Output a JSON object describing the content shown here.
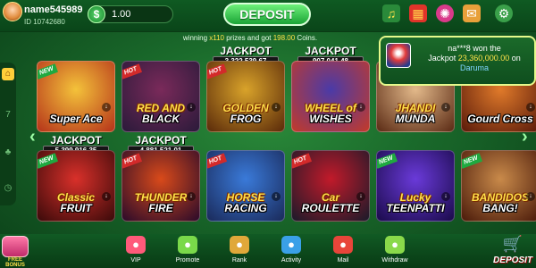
{
  "user": {
    "name": "name545989",
    "id_label": "ID 10742680"
  },
  "wallet": {
    "currency_symbol": "$",
    "balance": "1.00"
  },
  "header": {
    "deposit_label": "DEPOSIT"
  },
  "top_icons": [
    "gift-icon",
    "treasure-box-icon",
    "wheel-icon",
    "mail-icon",
    "settings-icon"
  ],
  "ticker": {
    "prefix": "winning ",
    "multiplier": "x110",
    "middle": " prizes and got ",
    "amount": "198.00",
    "suffix": " Coins."
  },
  "notification": {
    "player": "na***8 won the",
    "prefix": "Jackpot ",
    "amount": "23,360,000.00",
    "middle": " on",
    "game": "Daruma"
  },
  "jackpot_label": "JACKPOT",
  "games": [
    {
      "id": "super-ace",
      "name": "Super Ace",
      "badge": "NEW",
      "jackpot": null,
      "colors": [
        "#f4c23a",
        "#b5331a"
      ]
    },
    {
      "id": "red-and-black",
      "name": "RED AND BLACK",
      "line1": "RED AND",
      "line2": "BLACK",
      "badge": "HOT",
      "jackpot": null,
      "colors": [
        "#7a2a5a",
        "#2a1a3a"
      ]
    },
    {
      "id": "golden-frog",
      "name": "GOLDEN FROG",
      "line1": "GOLDEN",
      "line2": "FROG",
      "badge": "HOT",
      "jackpot": "3,322,539.67",
      "colors": [
        "#d9a32a",
        "#5a2a0a"
      ]
    },
    {
      "id": "wheel-of-wishes",
      "name": "WHEEL of WISHES",
      "line1": "WHEEL of",
      "line2": "WISHES",
      "badge": "",
      "jackpot": "907,041.48",
      "colors": [
        "#4a3aa8",
        "#c33a2a"
      ]
    },
    {
      "id": "jhandi-munda",
      "name": "JHANDI MUNDA",
      "line1": "JHANDI",
      "line2": "MUNDA",
      "badge": "",
      "jackpot": null,
      "colors": [
        "#e3b98a",
        "#5a2a14"
      ]
    },
    {
      "id": "gourd-cross",
      "name": "Gourd Cross",
      "badge": "",
      "jackpot": null,
      "colors": [
        "#e07a2a",
        "#5a1a0a"
      ]
    },
    {
      "id": "classic-fruit",
      "name": "Classic FRUIT",
      "line1": "Classic",
      "line2": "FRUIT",
      "badge": "NEW",
      "jackpot": "5,399,916.35",
      "colors": [
        "#d9302a",
        "#3a0a0a"
      ]
    },
    {
      "id": "thunder-fire",
      "name": "THUNDER FIRE",
      "line1": "THUNDER",
      "line2": "FIRE",
      "badge": "HOT",
      "jackpot": "4,881,521.01",
      "colors": [
        "#d94a1a",
        "#2a0a2a"
      ]
    },
    {
      "id": "horse-racing",
      "name": "HORSE RACING",
      "line1": "HORSE",
      "line2": "RACING",
      "badge": "HOT",
      "jackpot": null,
      "colors": [
        "#3a7ad9",
        "#1a2a5a"
      ]
    },
    {
      "id": "car-roulette",
      "name": "Car ROULETTE",
      "line1": "Car",
      "line2": "ROULETTE",
      "badge": "HOT",
      "jackpot": null,
      "colors": [
        "#c21a2a",
        "#1a1a2a"
      ]
    },
    {
      "id": "lucky-teenpatti",
      "name": "Lucky TEENPATTI",
      "line1": "Lucky",
      "line2": "TEENPATTI",
      "badge": "NEW",
      "jackpot": null,
      "colors": [
        "#6a3ad9",
        "#1a0a4a"
      ]
    },
    {
      "id": "bandidos-bang",
      "name": "BANDIDOS BANG",
      "line1": "BANDIDOS",
      "line2": "BANG!",
      "badge": "NEW",
      "jackpot": null,
      "colors": [
        "#c98a4a",
        "#4a1a0a"
      ]
    }
  ],
  "sidebar": {
    "items": [
      "home-icon",
      "777-icon",
      "cards-icon",
      "clock-icon"
    ]
  },
  "bottom_nav": {
    "free_bonus": "FREE BONUS",
    "items": [
      {
        "label": "VIP",
        "icon": "crown-icon",
        "color": "#ff5a7a"
      },
      {
        "label": "Promote",
        "icon": "money-bag-icon",
        "color": "#7ad94a"
      },
      {
        "label": "Rank",
        "icon": "trophy-icon",
        "color": "#e0a83a"
      },
      {
        "label": "Activity",
        "icon": "gift-box-icon",
        "color": "#3aa0e8"
      },
      {
        "label": "Mail",
        "icon": "mailbox-icon",
        "color": "#e8453a"
      },
      {
        "label": "Withdraw",
        "icon": "withdraw-icon",
        "color": "#8ad94a"
      }
    ],
    "deposit_label": "DEPOSIT"
  }
}
